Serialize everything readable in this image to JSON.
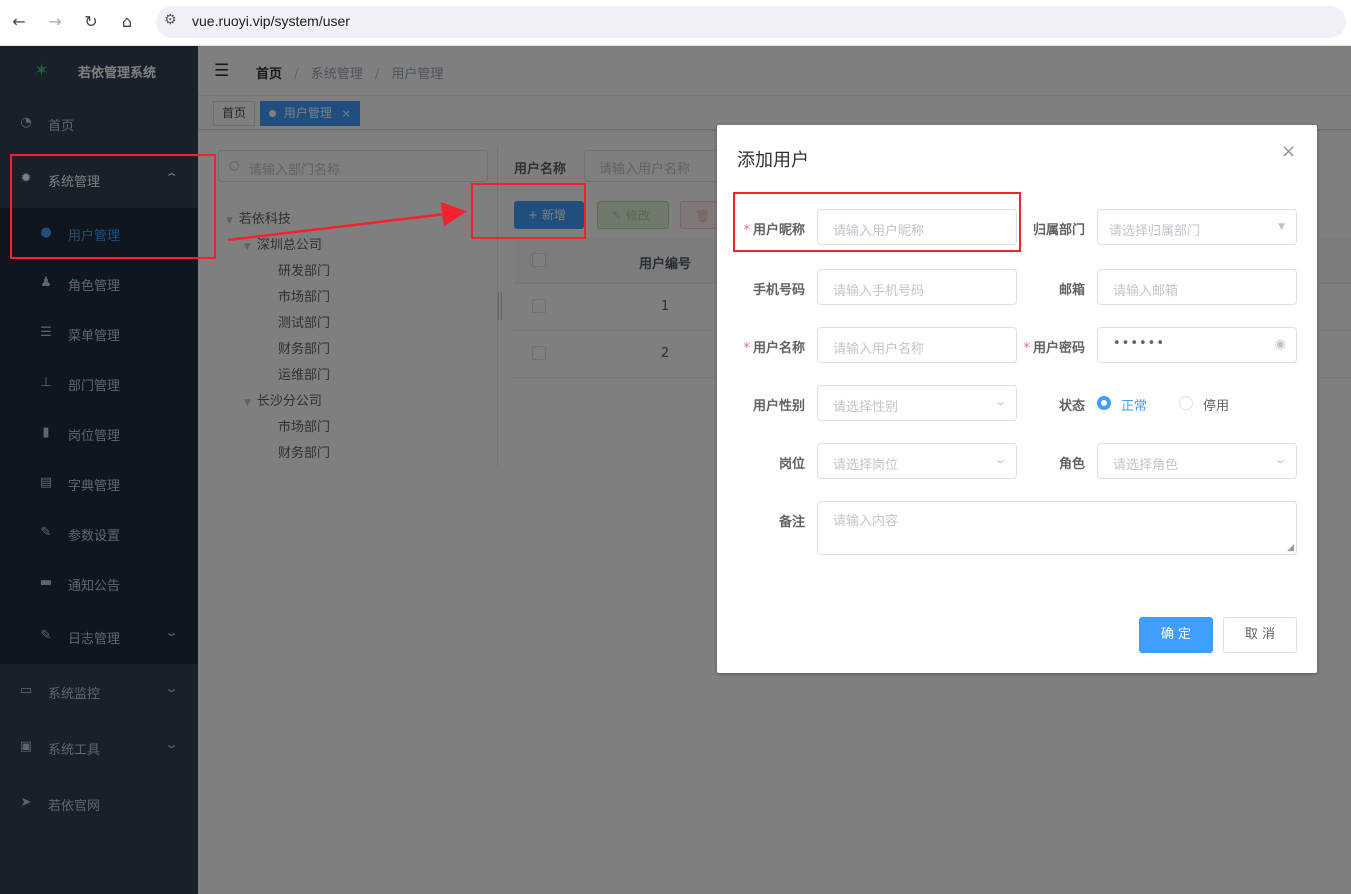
{
  "browser": {
    "url": "vue.ruoyi.vip/system/user"
  },
  "app": {
    "title": "若依管理系统"
  },
  "sidebar": {
    "home": "首页",
    "system": "系统管理",
    "sub": [
      "用户管理",
      "角色管理",
      "菜单管理",
      "部门管理",
      "岗位管理",
      "字典管理",
      "参数设置",
      "通知公告",
      "日志管理"
    ],
    "monitor": "系统监控",
    "tools": "系统工具",
    "site": "若依官网"
  },
  "breadcrumb": {
    "home": "首页",
    "sep": "/",
    "level1": "系统管理",
    "level2": "用户管理"
  },
  "tags": {
    "home": "首页",
    "user": "用户管理",
    "close": "×"
  },
  "dept": {
    "search_placeholder": "请输入部门名称",
    "tree": {
      "root": "若依科技",
      "sz": "深圳总公司",
      "sz_children": [
        "研发部门",
        "市场部门",
        "测试部门",
        "财务部门",
        "运维部门"
      ],
      "cs": "长沙分公司",
      "cs_children": [
        "市场部门",
        "财务部门"
      ]
    }
  },
  "search": {
    "label": "用户名称",
    "placeholder": "请输入用户名称"
  },
  "toolbar": {
    "add": "+ 新增",
    "edit": "修改"
  },
  "table": {
    "header": "用户编号",
    "rows": [
      "1",
      "2"
    ]
  },
  "dialog": {
    "title": "添加用户",
    "close": "×",
    "nickname": {
      "label": "用户昵称",
      "placeholder": "请输入用户昵称"
    },
    "dept": {
      "label": "归属部门",
      "placeholder": "请选择归属部门"
    },
    "phone": {
      "label": "手机号码",
      "placeholder": "请输入手机号码"
    },
    "email": {
      "label": "邮箱",
      "placeholder": "请输入邮箱"
    },
    "username": {
      "label": "用户名称",
      "placeholder": "请输入用户名称"
    },
    "password": {
      "label": "用户密码",
      "value": "••••••"
    },
    "sex": {
      "label": "用户性别",
      "placeholder": "请选择性别"
    },
    "status": {
      "label": "状态",
      "normal": "正常",
      "disabled": "停用",
      "selected": "正常"
    },
    "post": {
      "label": "岗位",
      "placeholder": "请选择岗位"
    },
    "role": {
      "label": "角色",
      "placeholder": "请选择角色"
    },
    "remark": {
      "label": "备注",
      "placeholder": "请输入内容"
    },
    "ok": "确 定",
    "cancel": "取 消",
    "required_mark": "*"
  },
  "colors": {
    "accent": "#409eff",
    "sidebar": "#304156",
    "annotation": "#f5222d"
  }
}
